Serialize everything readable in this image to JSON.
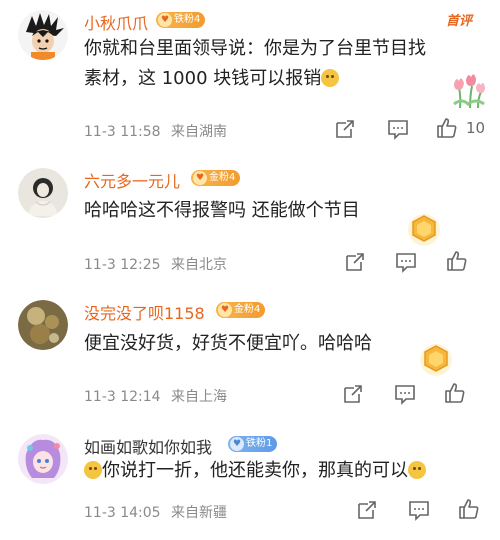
{
  "comments": [
    {
      "username": "小秋爪爪",
      "fan_badge": "铁粉4",
      "top_tag": "首评",
      "text_line1": "你就和台里面领导说：你是为了台里节目找",
      "text_line2": "素材，这 1000 块钱可以报销",
      "emoji": "doge-emoji",
      "time": "11-3 11:58",
      "location": "来自湖南",
      "like_count": "10",
      "sticker": "tulip-flowers"
    },
    {
      "username": "六元多一元儿",
      "fan_badge": "金粉4",
      "text": "哈哈哈这不得报警吗 还能做个节目",
      "time": "11-3 12:25",
      "location": "来自北京",
      "sticker": "gold-badge"
    },
    {
      "username": "没完没了呗1158",
      "fan_badge": "金粉4",
      "text": "便宜没好货，好货不便宜吖。哈哈哈",
      "time": "11-3 12:14",
      "location": "来自上海",
      "sticker": "gold-badge"
    },
    {
      "username": "如画如歌如你如我",
      "fan_badge": "铁粉1",
      "text": "你说打一折，他还能卖你，那真的可以",
      "time": "11-3 14:05",
      "location": "来自新疆"
    }
  ],
  "icons": {
    "share": "share-icon",
    "comment": "comment-icon",
    "like": "thumbs-up-icon"
  },
  "colors": {
    "username": "#e8661e",
    "meta": "#8a8a8a",
    "badge_gold": "#f5a73a",
    "badge_blue": "#6aa4ea"
  }
}
